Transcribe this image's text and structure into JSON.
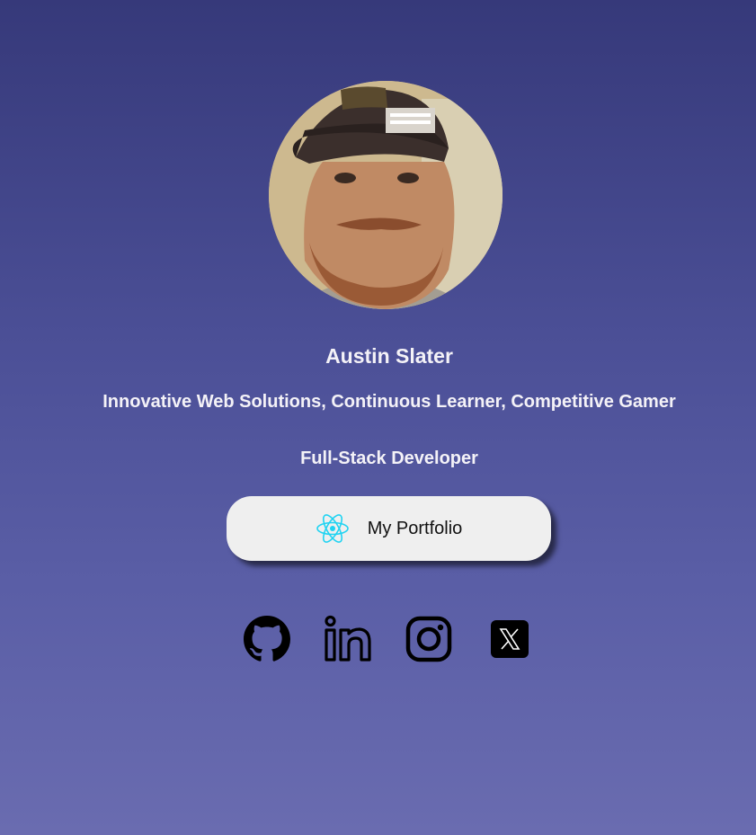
{
  "profile": {
    "name": "Austin Slater",
    "tagline": "Innovative Web Solutions, Continuous Learner, Competitive Gamer",
    "role": "Full-Stack Developer"
  },
  "portfolio_button": {
    "label": "My Portfolio",
    "icon": "react-icon",
    "icon_color": "#1fd3f2"
  },
  "socials": [
    {
      "icon": "github-icon"
    },
    {
      "icon": "linkedin-icon"
    },
    {
      "icon": "instagram-icon"
    },
    {
      "icon": "x-twitter-icon"
    }
  ],
  "colors": {
    "background_top": "#36397a",
    "background_bottom": "#6a6cb0",
    "text": "#f4f2f7",
    "button_bg": "#efefef"
  }
}
